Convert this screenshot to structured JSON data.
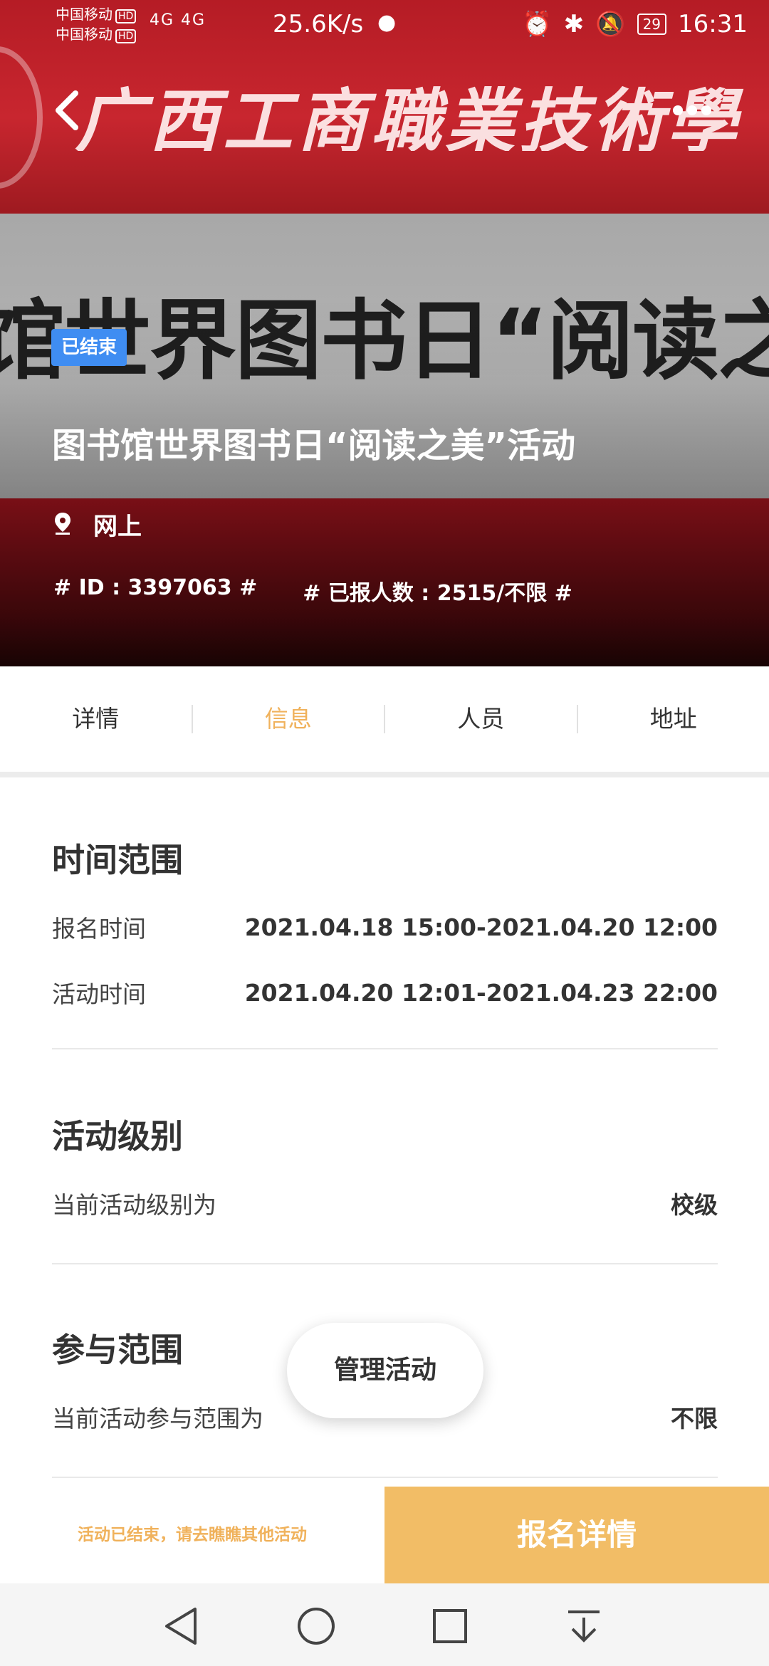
{
  "status_bar": {
    "carrier1": "中国移动",
    "carrier2": "中国移动",
    "hd": "HD",
    "network": "4G 4G",
    "speed": "25.6K/s",
    "battery": "29",
    "time": "16:31"
  },
  "banner": {
    "school_text": "广西工商職業技術學",
    "big_text": "馆世界图书日“阅读之美"
  },
  "activity": {
    "status_badge": "已结束",
    "title": "图书馆世界图书日“阅读之美”活动",
    "location": "网上",
    "id_tag": "# ID : 3397063 #",
    "enrolled_tag": "# 已报人数 : 2515/不限 #"
  },
  "tabs": [
    {
      "label": "详情",
      "active": false
    },
    {
      "label": "信息",
      "active": true
    },
    {
      "label": "人员",
      "active": false
    },
    {
      "label": "地址",
      "active": false
    }
  ],
  "time_section": {
    "title": "时间范围",
    "signup_label": "报名时间",
    "signup_value": "2021.04.18 15:00-2021.04.20 12:00",
    "activity_label": "活动时间",
    "activity_value": "2021.04.20 12:01-2021.04.23 22:00"
  },
  "level_section": {
    "title": "活动级别",
    "label": "当前活动级别为",
    "value": "校级"
  },
  "scope_section": {
    "title": "参与范围",
    "label": "当前活动参与范围为",
    "value": "不限"
  },
  "manage_button": "管理活动",
  "bottom_bar": {
    "ended_tip": "活动已结束，请去瞧瞧其他活动",
    "register_label": "报名详情"
  },
  "colors": {
    "accent": "#f0b25c",
    "badge_blue": "#3f8df2",
    "register_bg": "#f2bd66"
  },
  "icons": [
    "back-arrow-icon",
    "more-icon",
    "location-pin-icon",
    "nav-back-icon",
    "nav-home-icon",
    "nav-recents-icon",
    "nav-notifications-icon"
  ]
}
